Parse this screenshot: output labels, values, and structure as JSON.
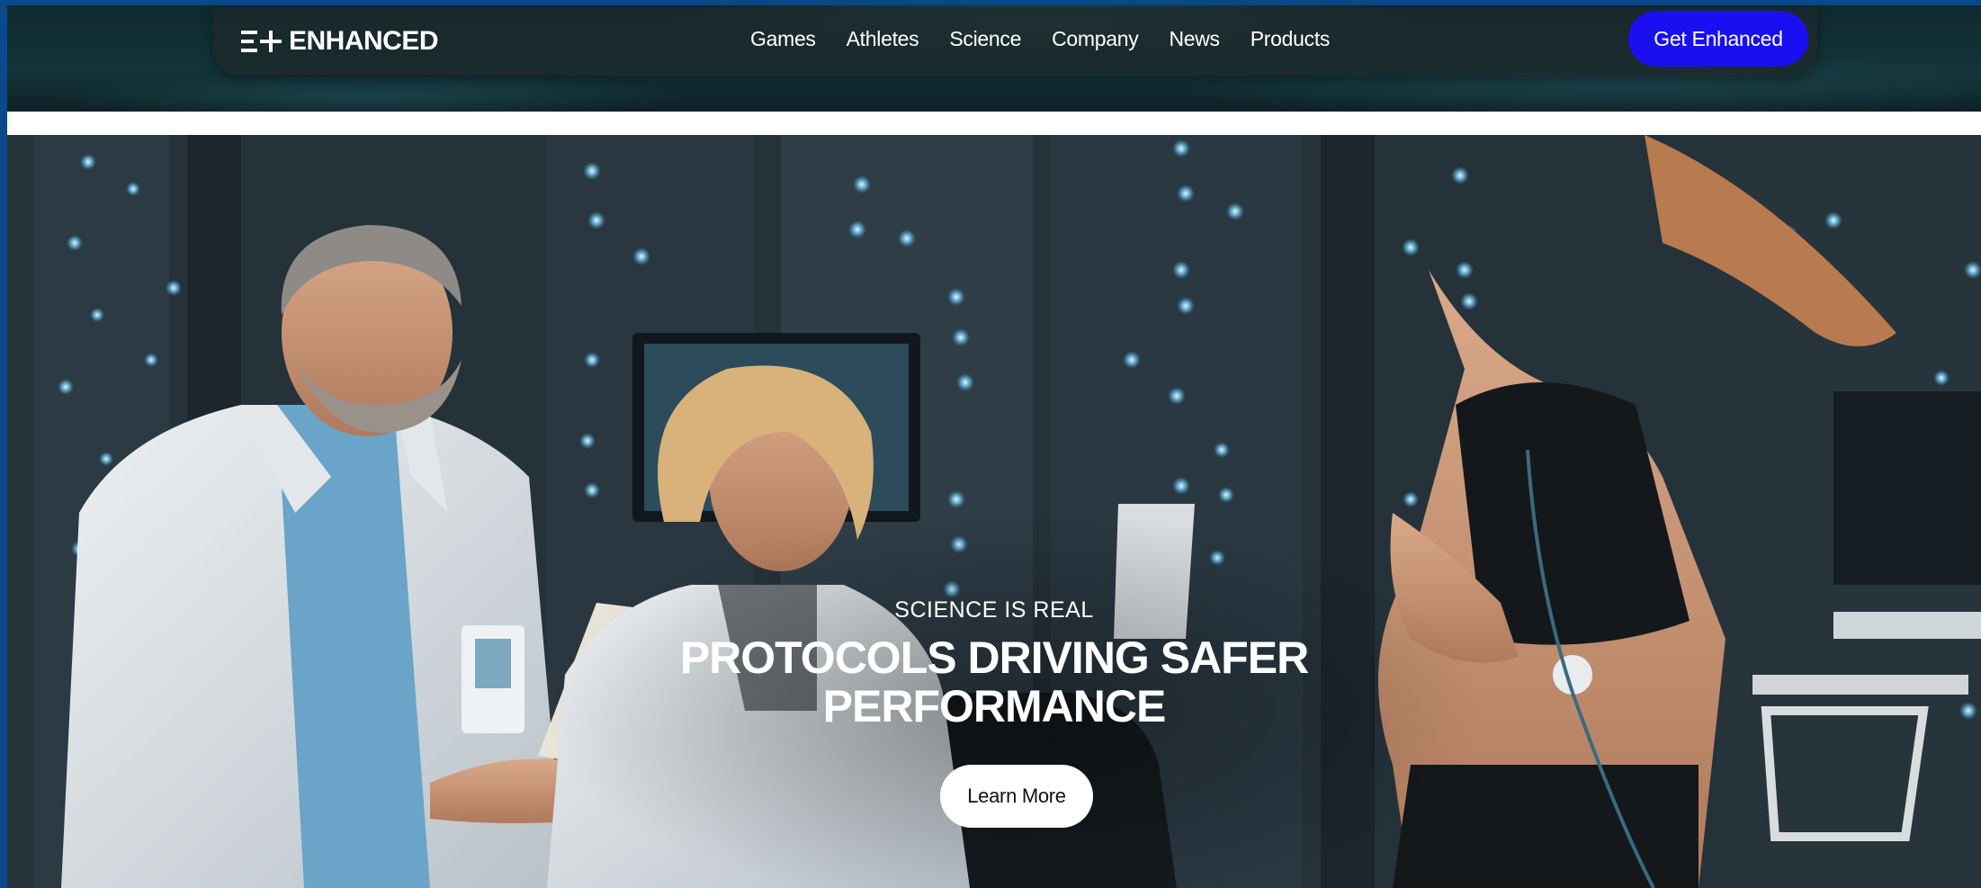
{
  "header": {
    "logo_text": "ENHANCED",
    "nav": [
      "Games",
      "Athletes",
      "Science",
      "Company",
      "News",
      "Products"
    ],
    "cta_label": "Get Enhanced"
  },
  "hero": {
    "eyebrow": "SCIENCE IS REAL",
    "headline_line1": "PROTOCOLS DRIVING SAFER",
    "headline_line2": "PERFORMANCE",
    "button_label": "Learn More"
  },
  "colors": {
    "accent": "#1a0ff0",
    "page_border": "#0a4a8c",
    "nav_background": "#1c282a"
  }
}
